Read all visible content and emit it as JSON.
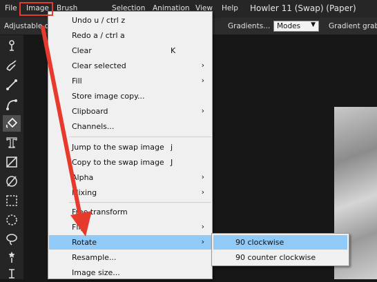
{
  "menubar": {
    "items": [
      "File",
      "Image",
      "Brush",
      "Selection",
      "Animation",
      "View",
      "Help"
    ],
    "title": "Howler 11  (Swap)  (Paper)"
  },
  "toolbar": {
    "left_label": "Adjustable c",
    "gradients_label": "Gradients...",
    "modes_value": "Modes",
    "gradient_grabber": "Gradient grabb"
  },
  "image_menu": [
    {
      "label": "Undo    u / ctrl z",
      "shortcut": "",
      "submenu": false
    },
    {
      "label": "Redo    a / ctrl a",
      "shortcut": "",
      "submenu": false
    },
    {
      "label": "Clear",
      "shortcut": "K",
      "submenu": false
    },
    {
      "label": "Clear selected",
      "shortcut": "",
      "submenu": true
    },
    {
      "label": "Fill",
      "shortcut": "",
      "submenu": true
    },
    {
      "label": "Store image copy...",
      "shortcut": "",
      "submenu": false
    },
    {
      "label": "Clipboard",
      "shortcut": "",
      "submenu": true
    },
    {
      "label": "Channels...",
      "shortcut": "",
      "submenu": false
    },
    {
      "label": "Jump to the swap image",
      "shortcut": "j",
      "submenu": false
    },
    {
      "label": "Copy to the swap image",
      "shortcut": "J",
      "submenu": false
    },
    {
      "label": "Alpha",
      "shortcut": "",
      "submenu": true
    },
    {
      "label": "Mixing",
      "shortcut": "",
      "submenu": true
    },
    {
      "label": "Free transform",
      "shortcut": "",
      "submenu": false
    },
    {
      "label": "Flip",
      "shortcut": "",
      "submenu": true
    },
    {
      "label": "Rotate",
      "shortcut": "",
      "submenu": true
    },
    {
      "label": "Resample...",
      "shortcut": "",
      "submenu": false
    },
    {
      "label": "Image size...",
      "shortcut": "",
      "submenu": false
    }
  ],
  "rotate_submenu": [
    "90 clockwise",
    "90 counter clockwise"
  ],
  "colors": {
    "highlight": "#91c9f7",
    "annotation": "#e53a2c",
    "menu_bg": "#f0f0f0",
    "app_bg": "#171717"
  },
  "tools": [
    "spray-icon",
    "brush-icon",
    "line-icon",
    "curve-icon",
    "fill-icon",
    "text-icon",
    "rectangle-icon",
    "ellipse-icon",
    "rect-select-icon",
    "ellipse-select-icon",
    "lasso-icon",
    "magic-wand-icon",
    "pin-icon"
  ]
}
